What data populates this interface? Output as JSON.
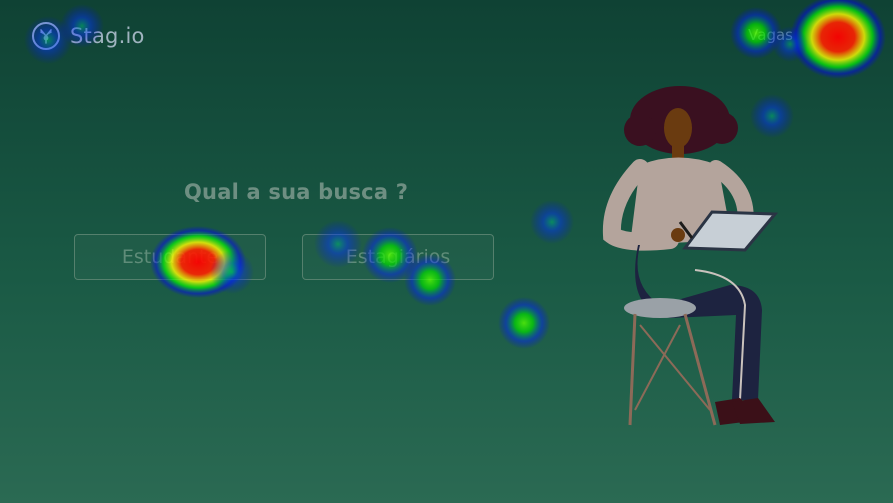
{
  "header": {
    "brand": "Stag.io",
    "logo_icon": "stag-logo-icon",
    "nav_link": "Vagas"
  },
  "search": {
    "title": "Qual a sua busca ?",
    "options": [
      {
        "label": "Estudante"
      },
      {
        "label": "Estagiários"
      }
    ]
  },
  "illustration": {
    "icon": "woman-with-tablet-illustration"
  },
  "heatmap": {
    "colors": {
      "hot": "#ff0000",
      "warm": "#ffff00",
      "mid": "#00ff00",
      "cool": "#0000ff"
    }
  }
}
